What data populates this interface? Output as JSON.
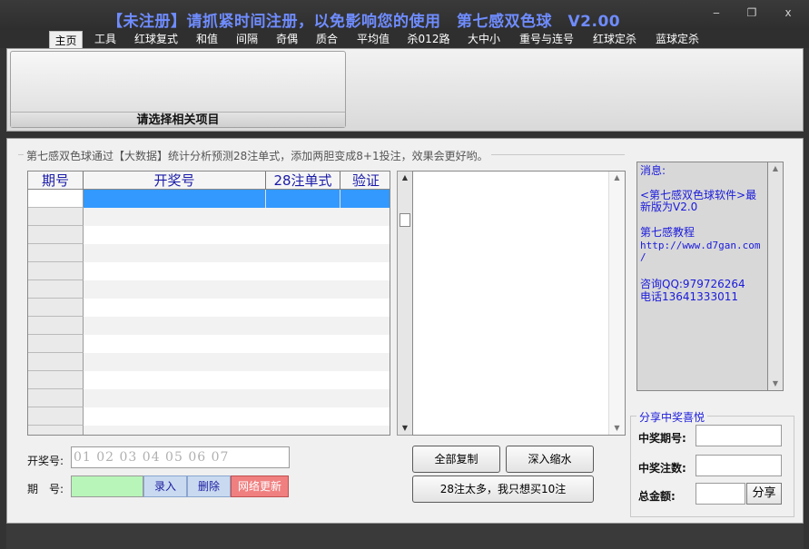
{
  "window": {
    "title": "【未注册】请抓紧时间注册，以免影响您的使用　第七感双色球　V2.00",
    "controls": {
      "minimize": "‒",
      "restore": "❐",
      "close": "x"
    }
  },
  "menu": {
    "tabs": [
      "主页",
      "工具",
      "红球复式",
      "和值",
      "间隔",
      "奇偶",
      "质合",
      "平均值",
      "杀012路",
      "大中小",
      "重号与连号",
      "红球定杀",
      "蓝球定杀"
    ],
    "active": "主页"
  },
  "ribbon": {
    "group_label": "请选择相关项目"
  },
  "main": {
    "legend": "第七感双色球通过【大数据】统计分析预测28注单式，添加两胆变成8+1投注，效果会更好哟。",
    "table": {
      "headers": [
        "期号",
        "开奖号",
        "28注单式",
        "验证"
      ]
    },
    "winning_label": "开奖号:",
    "winning_placeholder": "01  02  03  04  05  06  07",
    "period_label": "期　号:",
    "buttons": {
      "enter": "录入",
      "delete": "删除",
      "update": "网络更新",
      "copy_all": "全部复制",
      "deep_shrink": "深入缩水",
      "buy10": "28注太多，我只想买10注"
    }
  },
  "messages": {
    "title": "消息:",
    "line1": "<第七感双色球软件>最",
    "line2": "新版为V2.0",
    "tutorial": "第七感教程",
    "url1": "http://www.d7gan.com",
    "url2": "/",
    "qq": "咨询QQ:979726264",
    "phone": "电话13641333011"
  },
  "share": {
    "legend": "分享中奖喜悦",
    "period_label": "中奖期号:",
    "count_label": "中奖注数:",
    "total_label": "总金额:",
    "share_button": "分享"
  },
  "colors": {
    "accent": "#6f8cff",
    "selection": "#3399ff",
    "link": "#1a1adb"
  }
}
